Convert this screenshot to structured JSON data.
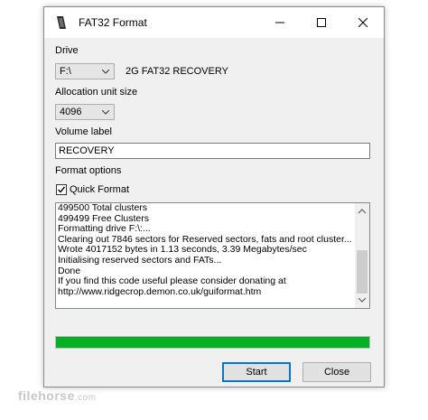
{
  "window": {
    "title": "FAT32 Format"
  },
  "drive": {
    "label": "Drive",
    "selected": "F:\\",
    "info": "2G FAT32 RECOVERY"
  },
  "allocation": {
    "label": "Allocation unit size",
    "selected": "4096"
  },
  "volume": {
    "label": "Volume label",
    "value": "RECOVERY"
  },
  "format_options": {
    "label": "Format options",
    "quick_format_label": "Quick Format",
    "quick_format_checked": true
  },
  "log": {
    "lines": [
      "499500 Total clusters",
      "499499 Free Clusters",
      "Formatting drive F:\\:...",
      "Clearing out 7846 sectors for Reserved sectors, fats and root cluster...",
      "Wrote 4017152 bytes in 1.13 seconds, 3.39 Megabytes/sec",
      "Initialising reserved sectors and FATs...",
      "Done",
      "If you find this code useful please consider donating at",
      "http://www.ridgecrop.demon.co.uk/guiformat.htm"
    ]
  },
  "progress": {
    "percent": 100,
    "color": "#06b025"
  },
  "buttons": {
    "start": "Start",
    "close": "Close"
  },
  "watermark": {
    "text": "filehorse",
    "suffix": ".com"
  }
}
